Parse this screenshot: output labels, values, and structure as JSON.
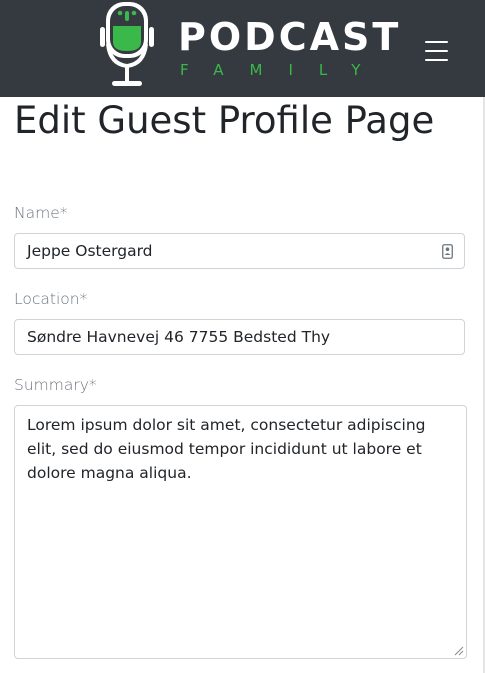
{
  "header": {
    "brand_name": "PODCAST",
    "brand_tagline": "FAMILY",
    "menu_icon": "hamburger-menu-icon",
    "logo_icon": "microphone-logo-icon",
    "colors": {
      "bar": "#343a40",
      "accent": "#3ab84a"
    }
  },
  "page": {
    "title": "Edit Guest Profile Page"
  },
  "form": {
    "name": {
      "label": "Name*",
      "value": "Jeppe Ostergard",
      "icon": "contact-card-icon"
    },
    "location": {
      "label": "Location*",
      "value": "Søndre Havnevej 46 7755 Bedsted Thy"
    },
    "summary": {
      "label": "Summary*",
      "value": "Lorem ipsum dolor sit amet, consectetur adipiscing elit, sed do eiusmod tempor incididunt ut labore et dolore magna aliqua."
    }
  }
}
